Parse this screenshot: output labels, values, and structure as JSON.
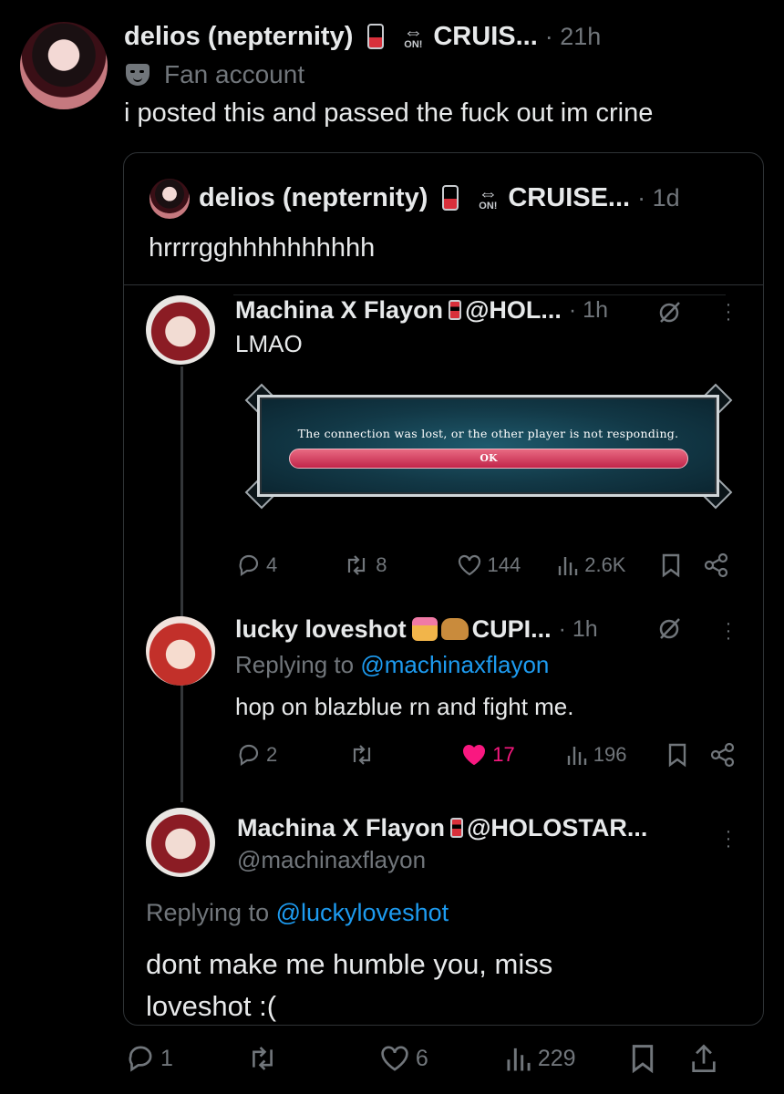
{
  "main_post": {
    "display_name": "delios (nepternity)",
    "badge_text": "ON!",
    "name_suffix": "CRUIS...",
    "time": "· 21h",
    "label": "Fan account",
    "label_icon": "mask-icon",
    "text": "i posted this and passed the fuck out im crine"
  },
  "quoted_post": {
    "display_name": "delios (nepternity)",
    "badge_text": "ON!",
    "name_suffix": "CRUISE...",
    "time": "· 1d",
    "text": "hrrrrgghhhhhhhhhh",
    "replies": [
      {
        "display_name": "Machina X Flayon",
        "handle": "@HOL...",
        "time": "· 1h",
        "text": "LMAO",
        "image": {
          "message": "The connection was lost, or the other player is not responding.",
          "button": "OK"
        },
        "stats": {
          "replies": "4",
          "reposts": "8",
          "likes": "144",
          "views": "2.6K"
        }
      },
      {
        "display_name": "lucky loveshot",
        "name_suffix": "CUPI...",
        "time": "· 1h",
        "replying_prefix": "Replying to",
        "replying_handle": "@machinaxflayon",
        "text": "hop on blazblue rn and fight me.",
        "stats": {
          "replies": "2",
          "reposts": "",
          "likes": "17",
          "views": "196"
        }
      },
      {
        "display_name": "Machina X Flayon",
        "handle_inline": "@HOLOSTAR...",
        "username": "@machinaxflayon",
        "replying_prefix": "Replying to",
        "replying_handle": "@luckyloveshot",
        "text_line1": "dont make me humble you, miss",
        "text_line2": "loveshot :("
      }
    ]
  },
  "footer_stats": {
    "replies": "1",
    "reposts": "",
    "likes": "6",
    "views": "229"
  },
  "colors": {
    "background": "#000000",
    "muted": "#71767b",
    "link": "#1d9bf0",
    "like_active": "#f91880"
  }
}
